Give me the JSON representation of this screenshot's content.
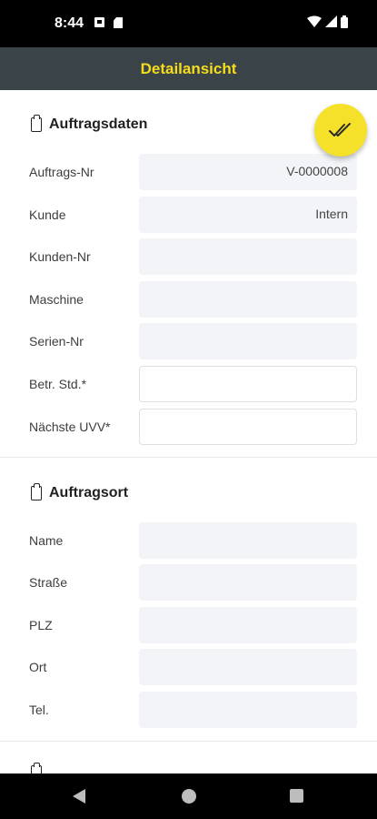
{
  "status_bar": {
    "time": "8:44"
  },
  "app_bar": {
    "title": "Detailansicht"
  },
  "sections": {
    "auftragsdaten": {
      "title": "Auftragsdaten",
      "rows": [
        {
          "label": "Auftrags-Nr",
          "value": "V-0000008"
        },
        {
          "label": "Kunde",
          "value": "Intern"
        },
        {
          "label": "Kunden-Nr",
          "value": ""
        },
        {
          "label": "Maschine",
          "value": ""
        },
        {
          "label": "Serien-Nr",
          "value": ""
        },
        {
          "label": "Betr. Std.*",
          "value": ""
        },
        {
          "label": "Nächste UVV*",
          "value": ""
        }
      ]
    },
    "auftragsort": {
      "title": "Auftragsort",
      "rows": [
        {
          "label": "Name",
          "value": ""
        },
        {
          "label": "Straße",
          "value": ""
        },
        {
          "label": "PLZ",
          "value": ""
        },
        {
          "label": "Ort",
          "value": ""
        },
        {
          "label": "Tel.",
          "value": ""
        }
      ]
    }
  },
  "colors": {
    "accent": "#f5dd1e",
    "app_bar": "#3a4347",
    "fab": "#f5e12a"
  },
  "icons": {
    "fab": "double-check-icon",
    "section": "clipboard-icon",
    "nav": [
      "back-icon",
      "home-icon",
      "recents-icon"
    ]
  }
}
